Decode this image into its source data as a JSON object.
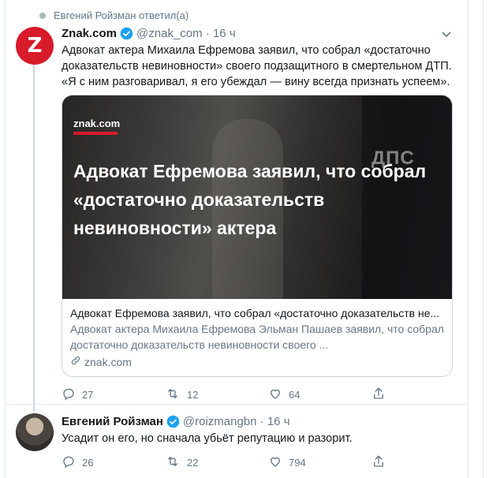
{
  "context_line": "Евгений Ройзман ответил(а)",
  "tweets": [
    {
      "name": "Znak.com",
      "handle": "@znak_com",
      "time": "16 ч",
      "avatar_letter": "Z",
      "text": "Адвокат актера Михаила Ефремова заявил, что собрал «достаточно доказательств невиновности» своего подзащитного в смертельном ДТП. «Я с ним разговаривал, я его убеждал — вину всегда признать успеем».",
      "card": {
        "logo": "znak.com",
        "headline": "Адвокат Ефремова заявил, что собрал «достаточно доказательств невиновности» актера",
        "image_overlay_text": "ДПС",
        "title": "Адвокат Ефремова заявил, что собрал «достаточно доказательств не...",
        "description": "Адвокат актера Михаила Ефремова Эльман Пашаев заявил, что собрал достаточно доказательств невиновности своего ...",
        "link": "znak.com"
      },
      "replies": "27",
      "retweets": "12",
      "likes": "64"
    },
    {
      "name": "Евгений Ройзман",
      "handle": "@roizmangbn",
      "time": "16 ч",
      "text": "Усадит он его, но сначала убьёт репутацию и разорит.",
      "replies": "26",
      "retweets": "22",
      "likes": "794"
    }
  ],
  "colors": {
    "text": "#14171a",
    "muted": "#657786",
    "verified": "#1da1f2",
    "znak_red": "#d71b2b",
    "border": "#e1e8ed"
  },
  "icons": [
    "dot-icon",
    "verified-icon",
    "chevron-down-icon",
    "reply-icon",
    "retweet-icon",
    "like-icon",
    "share-icon",
    "link-icon"
  ]
}
